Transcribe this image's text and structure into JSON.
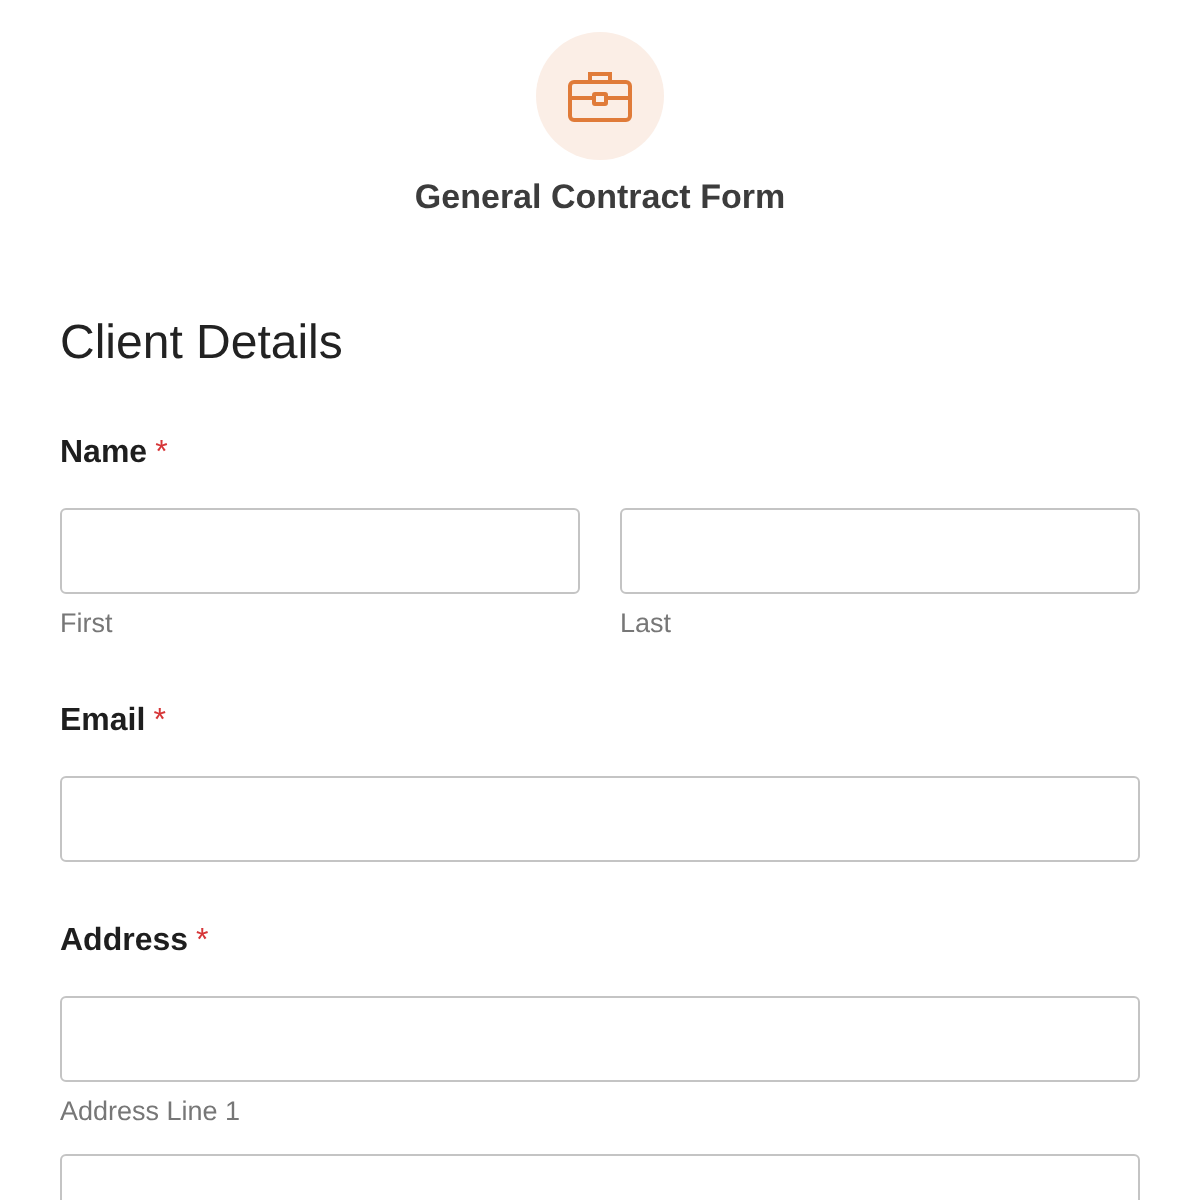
{
  "header": {
    "title": "General Contract Form"
  },
  "section": {
    "heading": "Client Details"
  },
  "fields": [
    {
      "label": "Name",
      "required_mark": "*",
      "inputs": [
        {
          "kind": "half",
          "sublabel": "First"
        },
        {
          "kind": "half",
          "sublabel": "Last"
        }
      ]
    },
    {
      "label": "Email",
      "required_mark": "*",
      "inputs": [
        {
          "kind": "full"
        }
      ]
    },
    {
      "label": "Address",
      "required_mark": "*",
      "inputs": [
        {
          "kind": "full",
          "sublabel": "Address Line 1"
        },
        {
          "kind": "full"
        }
      ]
    }
  ]
}
